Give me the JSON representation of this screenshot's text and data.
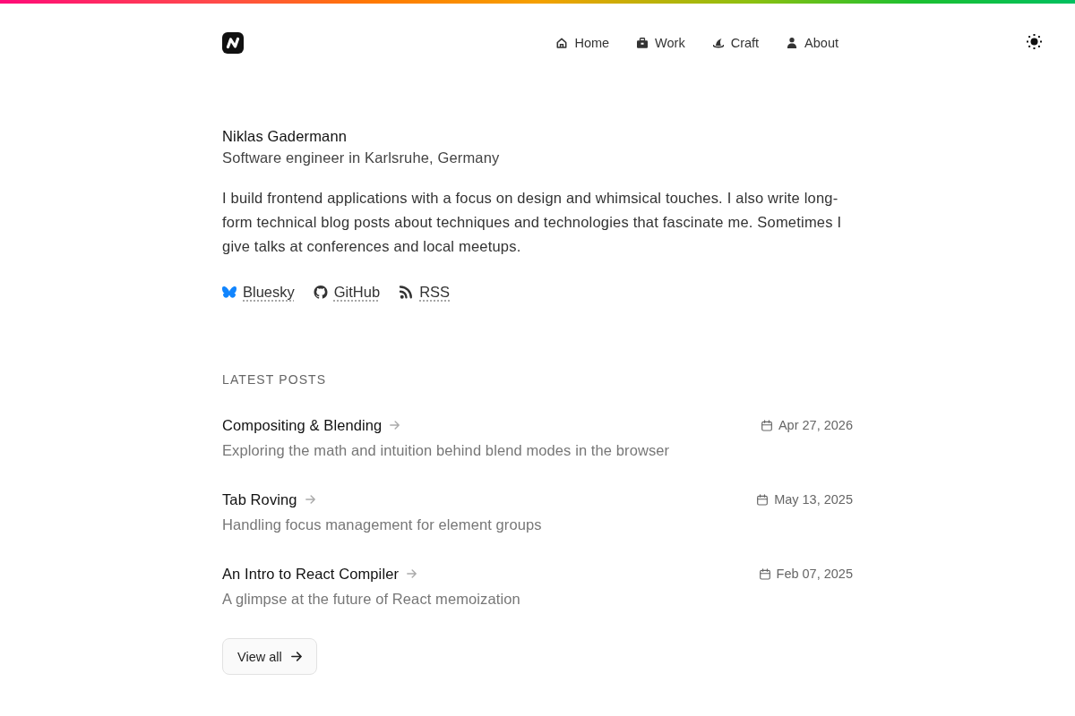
{
  "header": {
    "nav": [
      {
        "label": "Home"
      },
      {
        "label": "Work"
      },
      {
        "label": "Craft"
      },
      {
        "label": "About"
      }
    ]
  },
  "profile": {
    "name": "Niklas Gadermann",
    "tagline": "Software engineer in Karlsruhe, Germany",
    "bio": "I build frontend applications with a focus on design and whimsical touches. I also write long-form technical blog posts about techniques and technologies that fascinate me. Sometimes I give talks at conferences and local meetups.",
    "links": [
      {
        "label": "Bluesky"
      },
      {
        "label": "GitHub"
      },
      {
        "label": "RSS"
      }
    ]
  },
  "latest_posts": {
    "heading": "LATEST POSTS",
    "posts": [
      {
        "title": "Compositing & Blending",
        "description": "Exploring the math and intuition behind blend modes in the browser",
        "date": "Apr 27, 2026"
      },
      {
        "title": "Tab Roving",
        "description": "Handling focus management for element groups",
        "date": "May 13, 2025"
      },
      {
        "title": "An Intro to React Compiler",
        "description": "A glimpse at the future of React memoization",
        "date": "Feb 07, 2025"
      }
    ],
    "button": "View all"
  }
}
